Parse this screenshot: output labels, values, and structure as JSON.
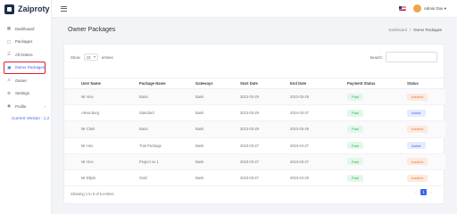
{
  "app": {
    "logo_text": "Zaiproty"
  },
  "sidebar": {
    "items": [
      {
        "label": "Dashboard",
        "icon": "dashboard-icon",
        "glyph": "▦"
      },
      {
        "label": "Packages",
        "icon": "box-icon",
        "glyph": "▢"
      },
      {
        "label": "All Orders",
        "icon": "orders-icon",
        "glyph": "☰"
      },
      {
        "label": "Owner Packages",
        "icon": "owner-packages-icon",
        "glyph": "▣"
      },
      {
        "label": "Owner",
        "icon": "user-icon",
        "glyph": "♙"
      },
      {
        "label": "Settings",
        "icon": "gear-icon",
        "glyph": "⚙"
      },
      {
        "label": "Profile",
        "icon": "profile-icon",
        "glyph": "◉",
        "chevron": "›"
      }
    ],
    "version": "Current Version : 1.2"
  },
  "header": {
    "admin_name": "Admin Doe ▾"
  },
  "page": {
    "title": "Owner Packages",
    "breadcrumb": {
      "home": "Dashboard",
      "separator": "/",
      "current": "Owner Packages"
    }
  },
  "table_controls": {
    "show_label": "Show",
    "entries_value": "10",
    "entries_label": "entries",
    "search_label": "Search:"
  },
  "table": {
    "columns": [
      "User Name",
      "Package Name",
      "Gateways",
      "Start Date",
      "End Date",
      "Payment Status",
      "Status"
    ],
    "rows": [
      {
        "user": "Mr Alex",
        "package": "Basic",
        "gateway": "Bank",
        "start": "2023-03-29",
        "end": "2023-03-29",
        "payment": "Paid",
        "status": "Inactive"
      },
      {
        "user": "Alexa Burg",
        "package": "Standard",
        "gateway": "Bank",
        "start": "2023-03-29",
        "end": "2024-03-27",
        "payment": "Paid",
        "status": "Active"
      },
      {
        "user": "Mr Clark",
        "package": "Basic",
        "gateway": "Bank",
        "start": "2023-03-29",
        "end": "2023-03-29",
        "payment": "Paid",
        "status": "Inactive"
      },
      {
        "user": "Mr Hex",
        "package": "Trial Package",
        "gateway": "Bank",
        "start": "2023-03-27",
        "end": "2023-04-27",
        "payment": "Paid",
        "status": "Active"
      },
      {
        "user": "Mr Alex",
        "package": "Project no 1",
        "gateway": "Bank",
        "start": "2023-03-27",
        "end": "2023-03-27",
        "payment": "Paid",
        "status": "Inactive"
      },
      {
        "user": "Mr Elljah",
        "package": "Gold",
        "gateway": "Bank",
        "start": "2023-03-27",
        "end": "2023-04-26",
        "payment": "Paid",
        "status": "Inactive"
      }
    ]
  },
  "footer": {
    "showing": "Showing 1 to 6 of 6 entries",
    "prev": "‹",
    "page": "1",
    "next": "›"
  },
  "colors": {
    "accent": "#3a66f0",
    "active_highlight_border": "#e11d2e",
    "paid": "#2fae5b",
    "inactive": "#e8793b"
  }
}
